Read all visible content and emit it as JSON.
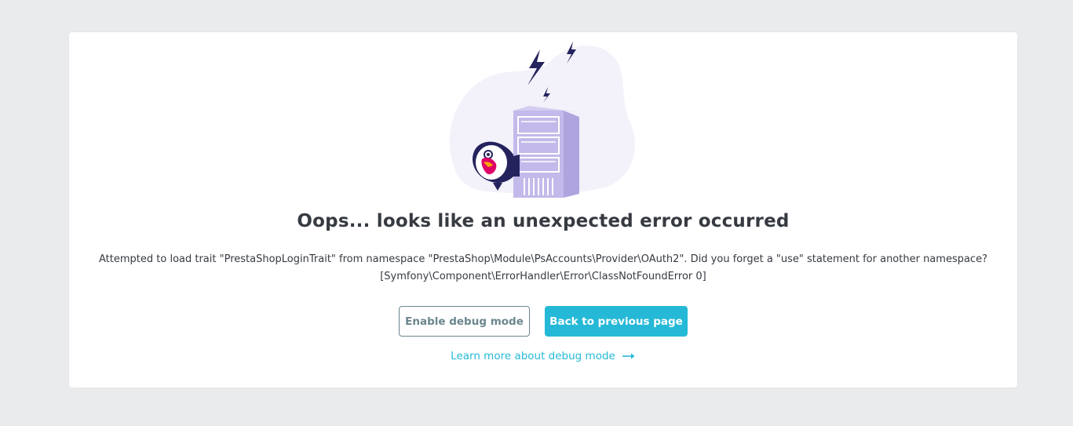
{
  "illustration": {
    "icon": "server-error-puffin-illustration",
    "colors": {
      "blob": "#f3f1fa",
      "server": "#c3b9ea",
      "server_outline": "#ffffff",
      "lightning": "#25235e"
    }
  },
  "error": {
    "title": "Oops... looks like an unexpected error occurred",
    "message_line1": "Attempted to load trait \"PrestaShopLoginTrait\" from namespace \"PrestaShop\\Module\\PsAccounts\\Provider\\OAuth2\". Did you forget a \"use\" statement for another namespace?",
    "message_line2": "[Symfony\\Component\\ErrorHandler\\Error\\ClassNotFoundError 0]"
  },
  "actions": {
    "debug_label": "Enable debug mode",
    "back_label": "Back to previous page"
  },
  "learn_more": {
    "label": "Learn more about debug mode",
    "icon": "arrow-right-icon"
  },
  "colors": {
    "background": "#eaebec",
    "accent": "#25b9d7",
    "text": "#363a41",
    "muted": "#6c868e"
  }
}
